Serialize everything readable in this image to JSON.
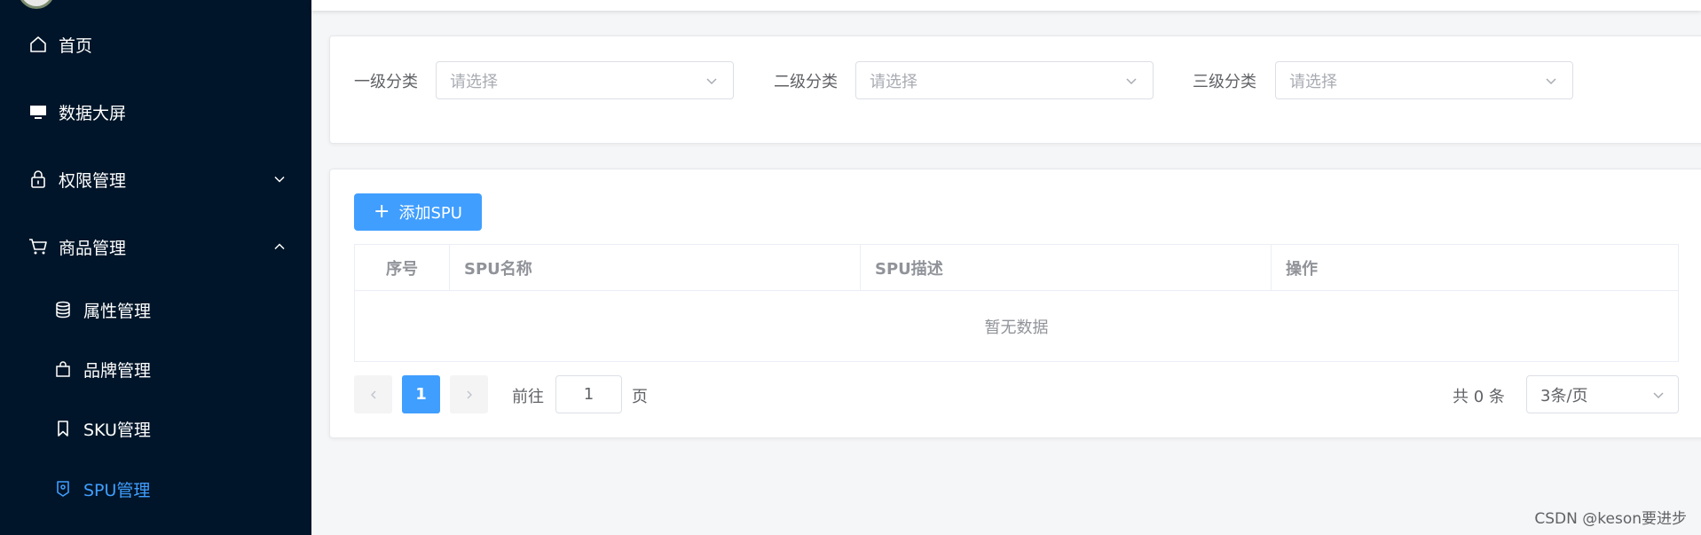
{
  "sidebar": {
    "items": [
      {
        "label": "首页",
        "icon": "home-icon"
      },
      {
        "label": "数据大屏",
        "icon": "monitor-icon"
      },
      {
        "label": "权限管理",
        "icon": "lock-icon"
      },
      {
        "label": "商品管理",
        "icon": "cart-icon"
      },
      {
        "label": "属性管理",
        "icon": "database-icon"
      },
      {
        "label": "品牌管理",
        "icon": "bag-icon"
      },
      {
        "label": "SKU管理",
        "icon": "bookmark-icon"
      },
      {
        "label": "SPU管理",
        "icon": "location-icon"
      }
    ],
    "active_item": "SPU管理"
  },
  "filters": {
    "level1_label": "一级分类",
    "level2_label": "二级分类",
    "level3_label": "三级分类",
    "placeholder": "请选择"
  },
  "main": {
    "add_button_label": "添加SPU",
    "columns": [
      "序号",
      "SPU名称",
      "SPU描述",
      "操作"
    ],
    "empty_text": "暂无数据"
  },
  "pagination": {
    "current_page": "1",
    "goto_label": "前往",
    "goto_value": "1",
    "page_unit": "页",
    "total_text": "共 0 条",
    "page_size": "3条/页"
  },
  "footer": {
    "watermark": "CSDN @keson要进步"
  },
  "colors": {
    "sidebar_bg": "#001529",
    "accent": "#409eff",
    "page_bg": "#f5f6f7"
  }
}
